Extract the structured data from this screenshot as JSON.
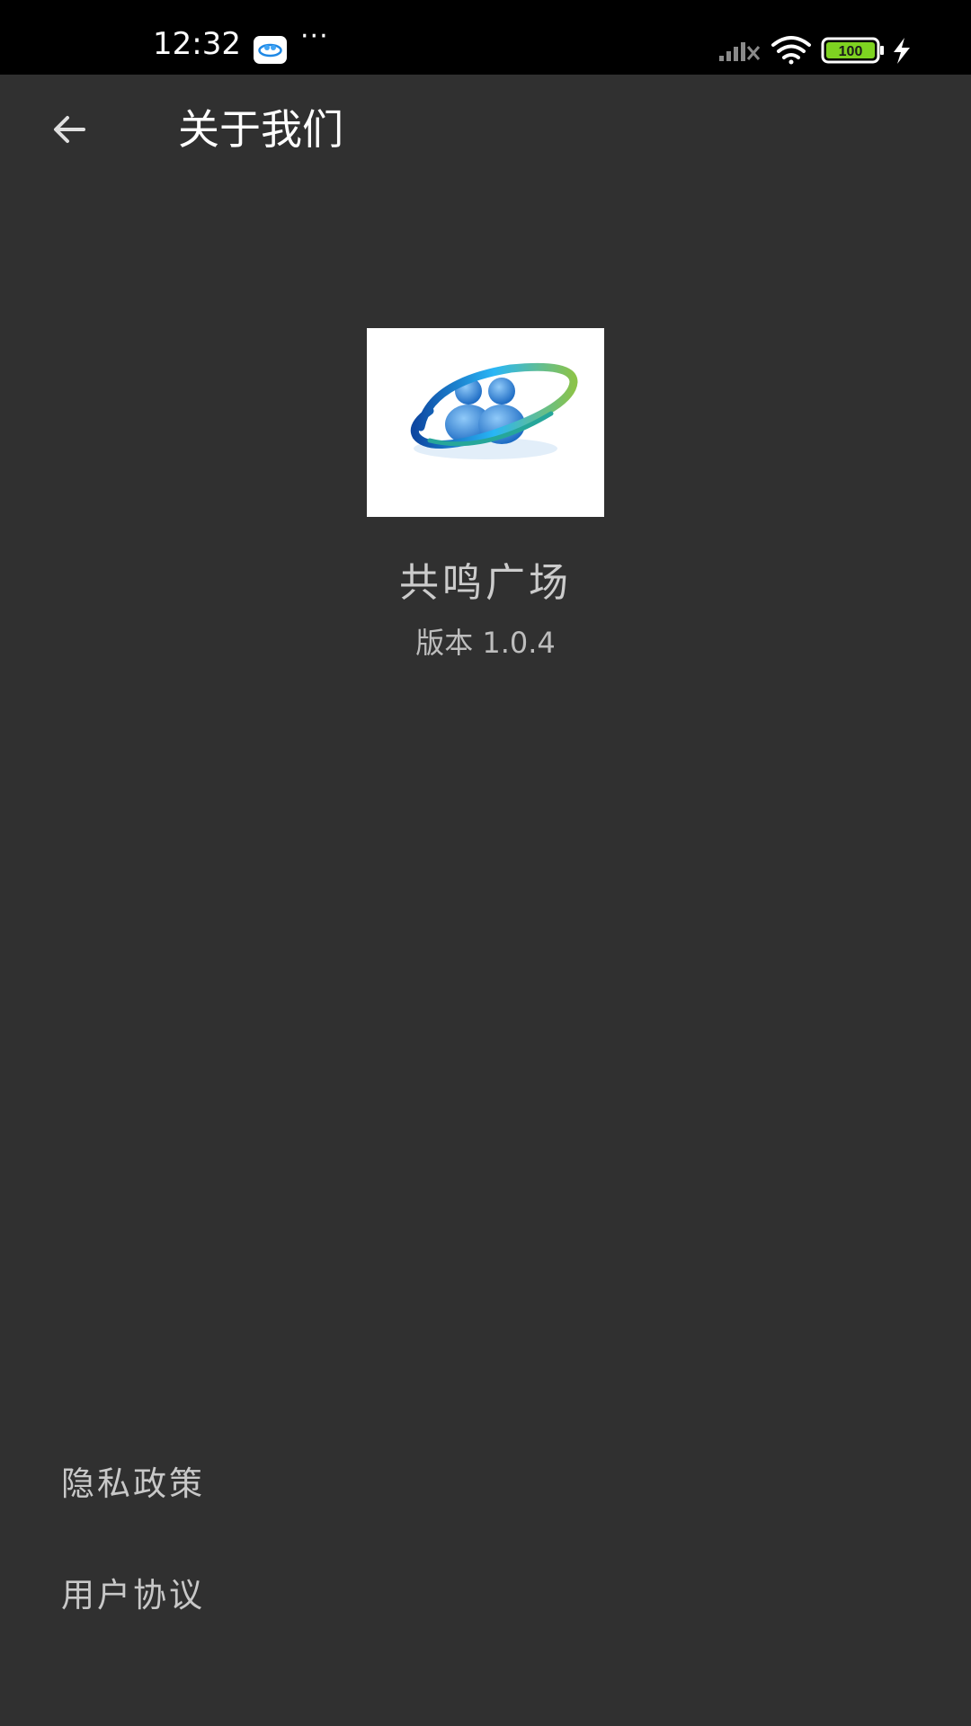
{
  "status_bar": {
    "time": "12:32",
    "dots": "···",
    "battery_level": "100",
    "icons": [
      "app-notification-icon",
      "signal-icon",
      "wifi-icon",
      "battery-icon",
      "charging-icon"
    ]
  },
  "header": {
    "title": "关于我们",
    "back_icon": "arrow-left-icon"
  },
  "app_info": {
    "name": "共鸣广场",
    "version": "版本 1.0.4",
    "logo_icon": "app-logo"
  },
  "links": {
    "privacy": "隐私政策",
    "agreement": "用户协议"
  },
  "colors": {
    "background": "#303030",
    "status_bar": "#000000",
    "battery_green": "#7ed321"
  }
}
